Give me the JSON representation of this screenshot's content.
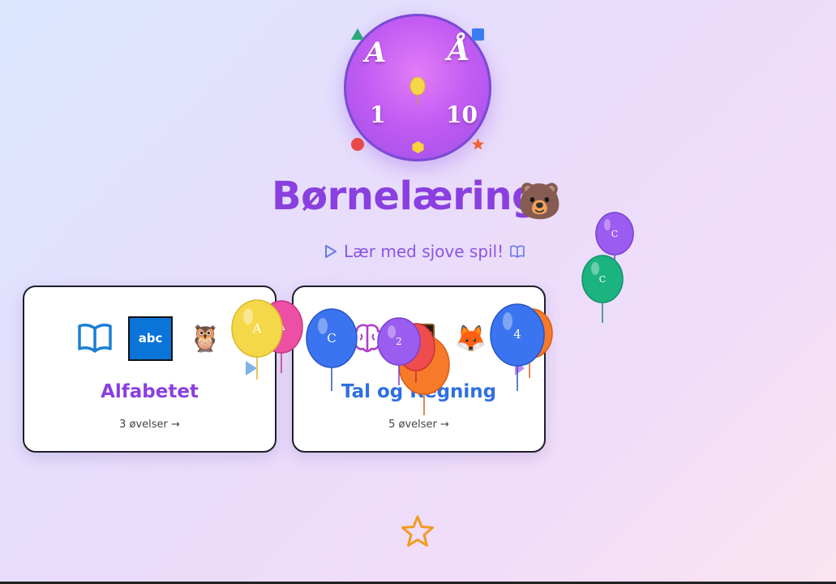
{
  "logo": {
    "glyph_top_left": "A",
    "glyph_top_right": "Å",
    "glyph_bottom_left": "1",
    "glyph_bottom_right": "10"
  },
  "header": {
    "title": "Børnelæring",
    "title_emoji": "🐻",
    "subtitle": "Lær med sjove spil!"
  },
  "cards": [
    {
      "title": "Alfabetet",
      "count": "3 øvelser →",
      "icons": [
        "open-book-icon",
        "abc-icon",
        "owl-icon"
      ],
      "abc_label": "abc",
      "owl_emoji": "🦉"
    },
    {
      "title": "Tal og Regning",
      "count": "5 øvelser →",
      "icons": [
        "brain-icon",
        "abacus-icon",
        "fox-icon"
      ],
      "fox_emoji": "🦊"
    }
  ],
  "balloons": [
    {
      "label": "A",
      "color": "#f5d84a"
    },
    {
      "label": "A",
      "color": "#ec4fa3"
    },
    {
      "label": "C",
      "color": "#3b74f0"
    },
    {
      "label": "2",
      "color": "#9b5cf0"
    },
    {
      "label": "",
      "color": "#ef4d4d"
    },
    {
      "label": "",
      "color": "#f7792a"
    },
    {
      "label": "4",
      "color": "#3b74f0"
    },
    {
      "label": "",
      "color": "#f7792a"
    },
    {
      "label": "C",
      "color": "#9b5cf0"
    },
    {
      "label": "C",
      "color": "#1bb380"
    }
  ],
  "colors": {
    "accent_purple": "#8a3fe0",
    "accent_blue": "#2f6fe0",
    "star": "#f39a1d"
  }
}
